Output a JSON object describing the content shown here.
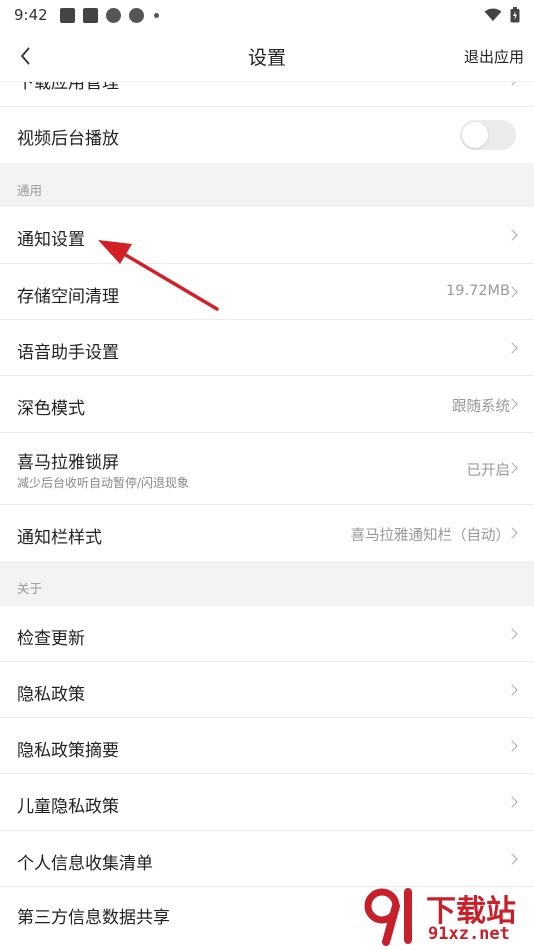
{
  "status_bar": {
    "time": "9:42"
  },
  "nav": {
    "title": "设置",
    "exit_label": "退出应用"
  },
  "partial_row": {
    "label": "下载应用管理"
  },
  "video_bg": {
    "label": "视频后台播放",
    "enabled": false
  },
  "sections": {
    "general": "通用",
    "about": "关于"
  },
  "general_items": [
    {
      "label": "通知设置",
      "value": ""
    },
    {
      "label": "存储空间清理",
      "value": "19.72MB"
    },
    {
      "label": "语音助手设置",
      "value": ""
    },
    {
      "label": "深色模式",
      "value": "跟随系统"
    },
    {
      "label": "喜马拉雅锁屏",
      "sub": "减少后台收听自动暂停/闪退现象",
      "value": "已开启"
    },
    {
      "label": "通知栏样式",
      "value": "喜马拉雅通知栏（自动）"
    }
  ],
  "about_items": [
    {
      "label": "检查更新"
    },
    {
      "label": "隐私政策"
    },
    {
      "label": "隐私政策摘要"
    },
    {
      "label": "儿童隐私政策"
    },
    {
      "label": "个人信息收集清单"
    },
    {
      "label": "第三方信息数据共享"
    }
  ],
  "watermark": {
    "brand": "下载站",
    "url": "91xz.net"
  },
  "colors": {
    "annotation_arrow": "#d32027",
    "watermark": "#c8202a"
  }
}
